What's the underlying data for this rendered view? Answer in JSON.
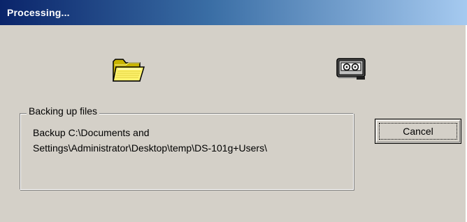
{
  "window": {
    "title": "Processing..."
  },
  "icons": {
    "source": "folder-icon",
    "destination": "tape-drive-icon"
  },
  "group": {
    "label": "Backing up files",
    "line1": "Backup C:\\Documents and",
    "line2": "Settings\\Administrator\\Desktop\\temp\\DS-101g+Users\\"
  },
  "buttons": {
    "cancel_label": "Cancel"
  },
  "colors": {
    "titlebar_start": "#0a246a",
    "titlebar_end": "#a6caf0",
    "dialog_bg": "#d4d0c8"
  }
}
